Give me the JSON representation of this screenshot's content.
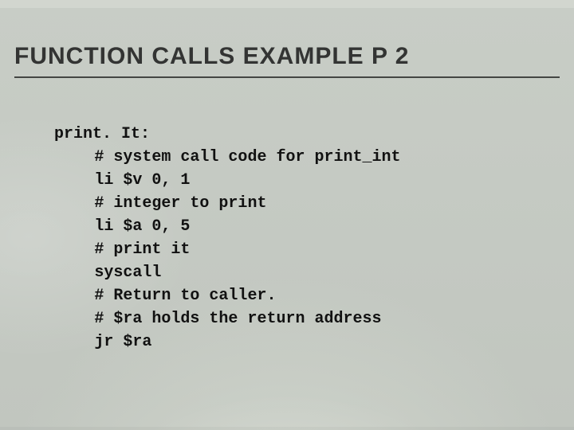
{
  "title": "FUNCTION CALLS EXAMPLE P 2",
  "code": {
    "label": "print. It:",
    "lines": [
      "# system call code for print_int",
      "li $v 0, 1",
      "# integer to print",
      "li $a 0, 5",
      "# print it",
      "syscall",
      "# Return to caller.",
      "# $ra holds the return address",
      "jr $ra"
    ]
  }
}
